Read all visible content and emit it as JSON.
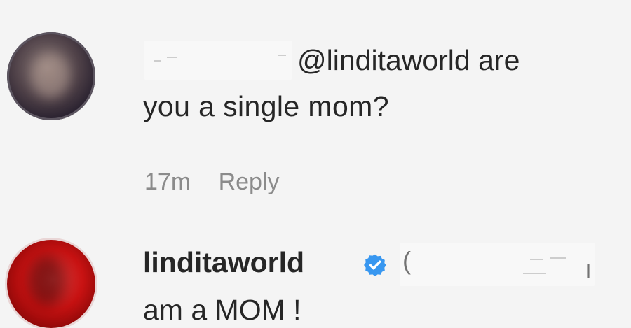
{
  "comments": [
    {
      "mention": "@linditaworld are",
      "text_line_2": "you a single mom?",
      "time": "17m",
      "reply_label": "Reply"
    },
    {
      "username": "linditaworld",
      "reply_text": "am a MOM !"
    }
  ],
  "colors": {
    "verified_badge": "#3897f0",
    "primary_text": "#262626",
    "meta_text": "#8b8b8b",
    "background": "#f4f4f4"
  },
  "icons": {
    "verified": "verified-badge-icon"
  }
}
